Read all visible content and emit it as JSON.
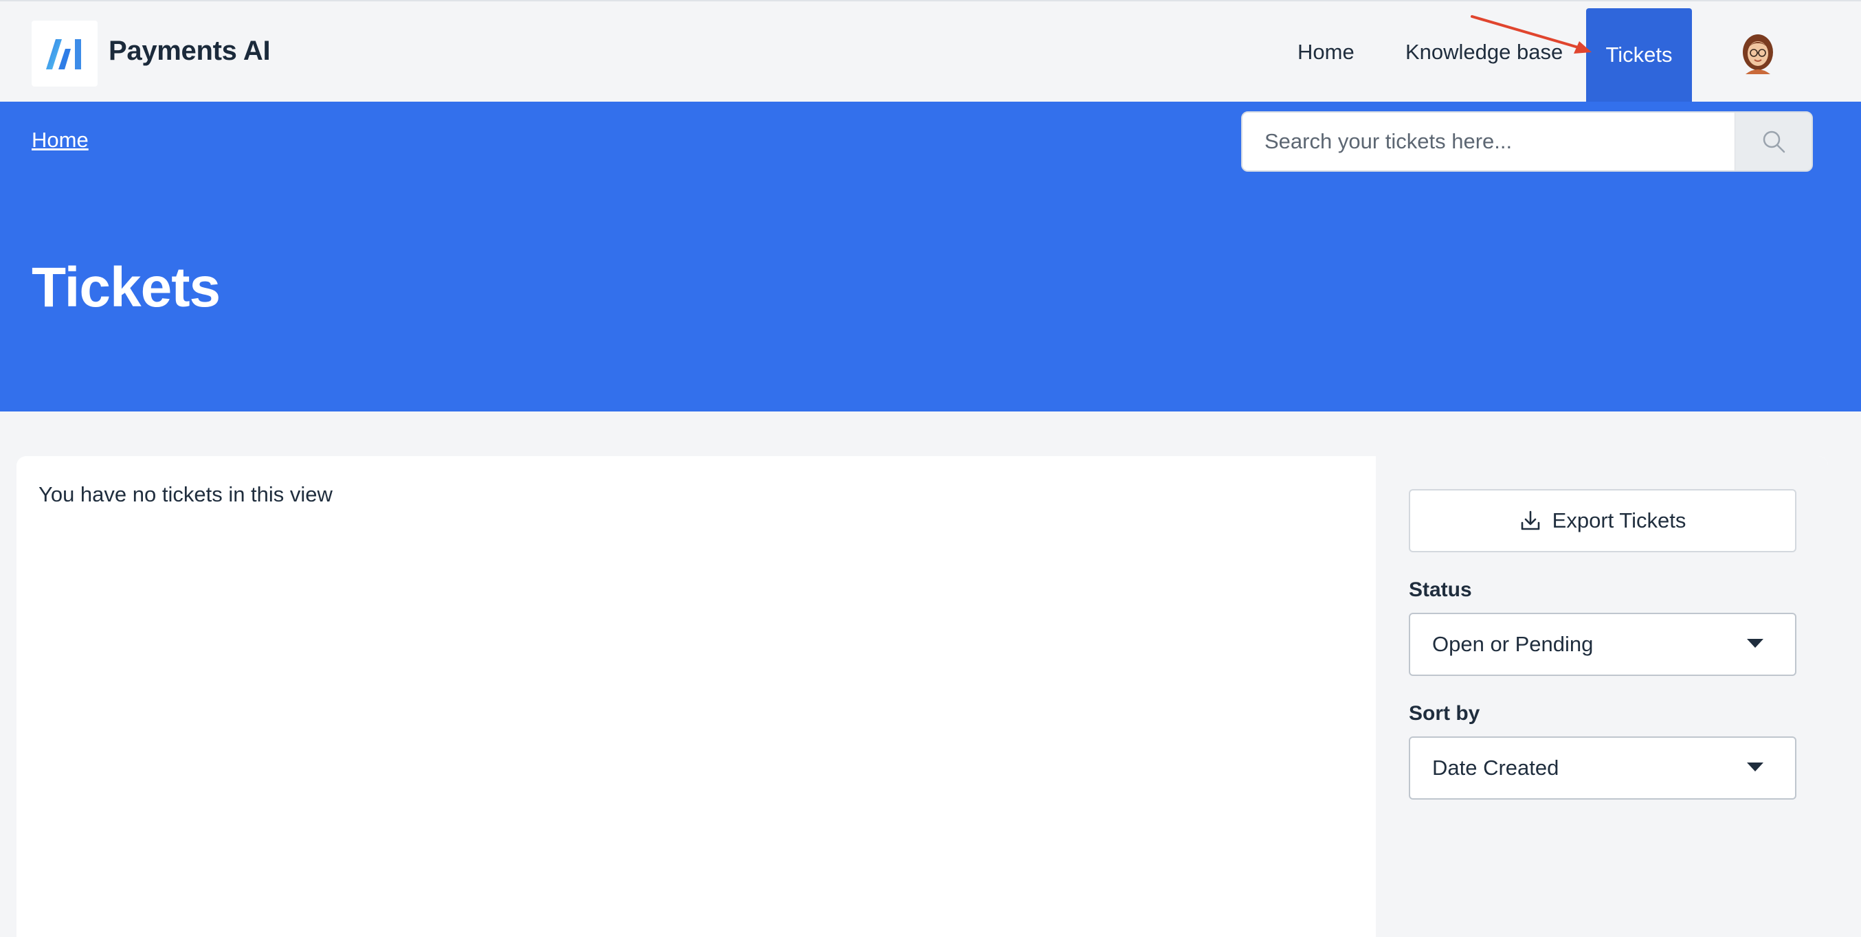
{
  "header": {
    "brand": "Payments AI",
    "logo_icon": "ai-logo-icon",
    "nav": {
      "home": "Home",
      "knowledge_base": "Knowledge base",
      "tickets": "Tickets"
    },
    "active_nav": "Tickets",
    "avatar_icon": "user-avatar-icon"
  },
  "hero": {
    "breadcrumb": "Home",
    "search_placeholder": "Search your tickets here...",
    "search_icon": "search-icon",
    "title": "Tickets"
  },
  "main": {
    "empty_message": "You have no tickets in this view"
  },
  "sidebar": {
    "export_label": "Export Tickets",
    "export_icon": "download-icon",
    "status_label": "Status",
    "status_value": "Open or Pending",
    "sort_label": "Sort by",
    "sort_value": "Date Created"
  },
  "colors": {
    "accent": "#3370ec",
    "active_tab": "#2f66db",
    "annotation_arrow": "#e0452e"
  }
}
